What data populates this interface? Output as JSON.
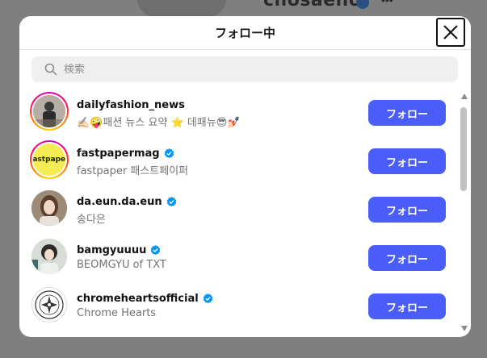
{
  "background": {
    "username": "chosaeno"
  },
  "modal": {
    "title": "フォロー中",
    "close_icon": "x-icon"
  },
  "search": {
    "placeholder": "検索",
    "value": "",
    "icon": "search-icon"
  },
  "follow_label": "フォロー",
  "colors": {
    "follow_button": "#4a5df9",
    "verified": "#0095f6",
    "story_ring": [
      "#d300c5",
      "#ff0069",
      "#ffd600"
    ]
  },
  "users": [
    {
      "username": "dailyfashion_news",
      "subtitle": "✍🏻🤪패션 뉴스 요약 ⭐ 데패뉴😎💅🏻",
      "verified": false,
      "story_ring": true,
      "avatar": "person-photo"
    },
    {
      "username": "fastpapermag",
      "subtitle": "fastpaper 패스트페이퍼",
      "verified": true,
      "story_ring": true,
      "avatar_text": "fastpaper"
    },
    {
      "username": "da.eun.da.eun",
      "subtitle": "송다은",
      "verified": true,
      "story_ring": false,
      "avatar": "person-photo"
    },
    {
      "username": "bamgyuuuu",
      "subtitle": "BEOMGYU of TXT",
      "verified": true,
      "story_ring": false,
      "avatar": "person-photo"
    },
    {
      "username": "chromeheartsofficial",
      "subtitle": "Chrome Hearts",
      "verified": true,
      "story_ring": false,
      "avatar": "cross-logo"
    }
  ]
}
